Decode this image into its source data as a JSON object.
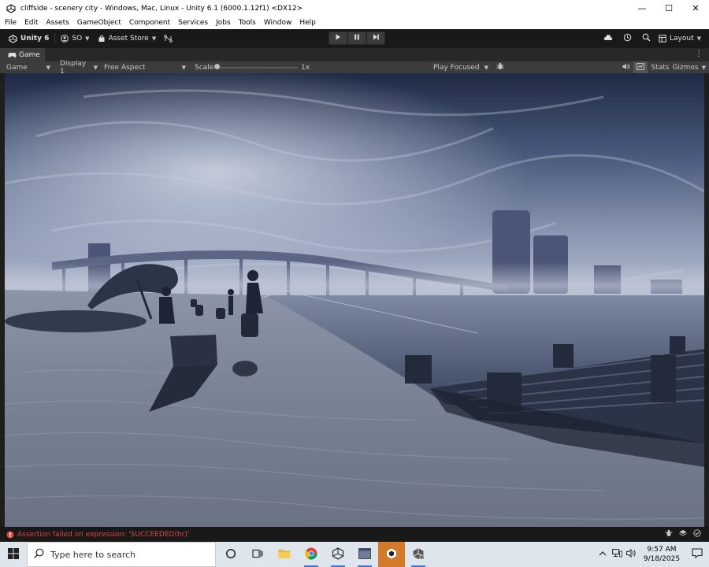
{
  "window": {
    "title": "cliffside - scenery city - Windows, Mac, Linux - Unity 6.1 (6000.1.12f1) <DX12>",
    "minimize_glyph": "—",
    "maximize_glyph": "☐",
    "close_glyph": "✕"
  },
  "menu": {
    "items": [
      "File",
      "Edit",
      "Assets",
      "GameObject",
      "Component",
      "Services",
      "Jobs",
      "Tools",
      "Window",
      "Help"
    ]
  },
  "toolbar": {
    "unity_label": "Unity 6",
    "account_label": "SO",
    "asset_store_label": "Asset Store",
    "layout_label": "Layout",
    "icons": [
      "unity-logo-icon",
      "account-icon",
      "asset-store-icon",
      "source-control-icon",
      "play-icon",
      "pause-icon",
      "step-icon",
      "cloud-icon",
      "history-icon",
      "search-icon",
      "layout-icon"
    ]
  },
  "tabs": {
    "game_label": "Game"
  },
  "game_bar": {
    "mode": "Game",
    "display": "Display 1",
    "aspect": "Free Aspect",
    "scale_label": "Scale",
    "scale_value": "1x",
    "play_mode": "Play Focused",
    "stats_label": "Stats",
    "gizmos_label": "Gizmos"
  },
  "status": {
    "error_message": "Assertion failed on expression: 'SUCCEEDED(hr)'",
    "error_color": "#e04646"
  },
  "taskbar": {
    "search_placeholder": "Type here to search",
    "time": "9:57 AM",
    "date": "9/18/2025",
    "apps": [
      "cortana-icon",
      "task-view-icon",
      "file-explorer-icon",
      "chrome-icon",
      "unity-hub-icon",
      "window-app-icon",
      "unity-editor-icon",
      "unity-app-icon"
    ]
  },
  "colors": {
    "accent": "#d07a2a",
    "editor_bg": "#191919",
    "panel_bg": "#3c3c3c"
  }
}
